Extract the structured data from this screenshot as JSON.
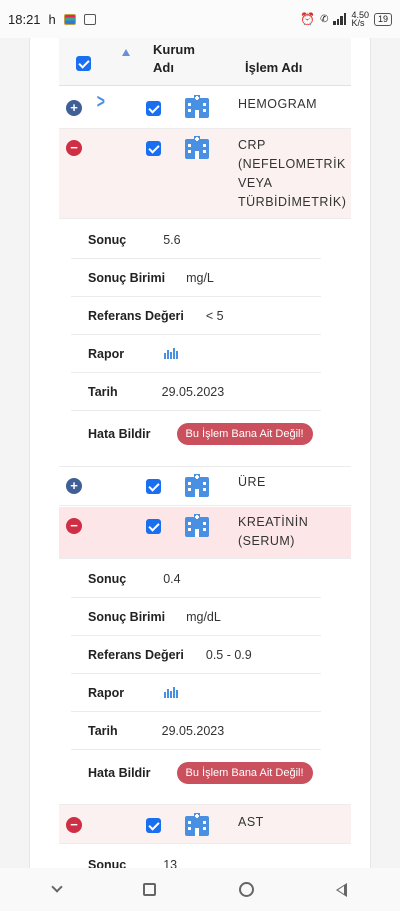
{
  "status": {
    "time": "18:21",
    "indicator": "h",
    "network_speed": "4.50\nK/s",
    "battery": "19"
  },
  "table": {
    "header_kurum": "Kurum Adı",
    "header_kurum_line1": "Kurum",
    "header_kurum_line2": "Adı",
    "header_islem": "İşlem Adı"
  },
  "rows": [
    {
      "name": "HEMOGRAM",
      "expanded": false
    },
    {
      "name": "CRP (NEFELOMETRİK VEYA TÜRBİDİMETRİK)",
      "expanded": true
    },
    {
      "name": "ÜRE",
      "expanded": false
    },
    {
      "name": "KREATİNİN (SERUM)",
      "expanded": true
    },
    {
      "name": "AST",
      "expanded": true
    }
  ],
  "labels": {
    "sonuc": "Sonuç",
    "sonuc_birimi": "Sonuç Birimi",
    "referans": "Referans Değeri",
    "rapor": "Rapor",
    "tarih": "Tarih",
    "hata": "Hata Bildir",
    "error_button": "Bu İşlem Bana Ait Değil!"
  },
  "crp": {
    "sonuc": "5.6",
    "birim": "mg/L",
    "referans": "< 5",
    "tarih": "29.05.2023"
  },
  "kreatinin": {
    "sonuc": "0.4",
    "birim": "mg/dL",
    "referans": "0.5 - 0.9",
    "tarih": "29.05.2023"
  },
  "ast": {
    "sonuc": "13"
  },
  "colors": {
    "checkbox": "#1a6ef0",
    "expand_button": "#3f5f96",
    "collapse_button": "#cf2f44",
    "error_button": "#c9505c",
    "hospital_icon": "#4a90e2",
    "expanded_row_bg": "#fde6e8"
  },
  "icons": {
    "expand": "plus-circle-icon",
    "collapse": "minus-circle-icon",
    "kurum": "hospital-building-icon",
    "rapor": "bar-chart-icon"
  }
}
